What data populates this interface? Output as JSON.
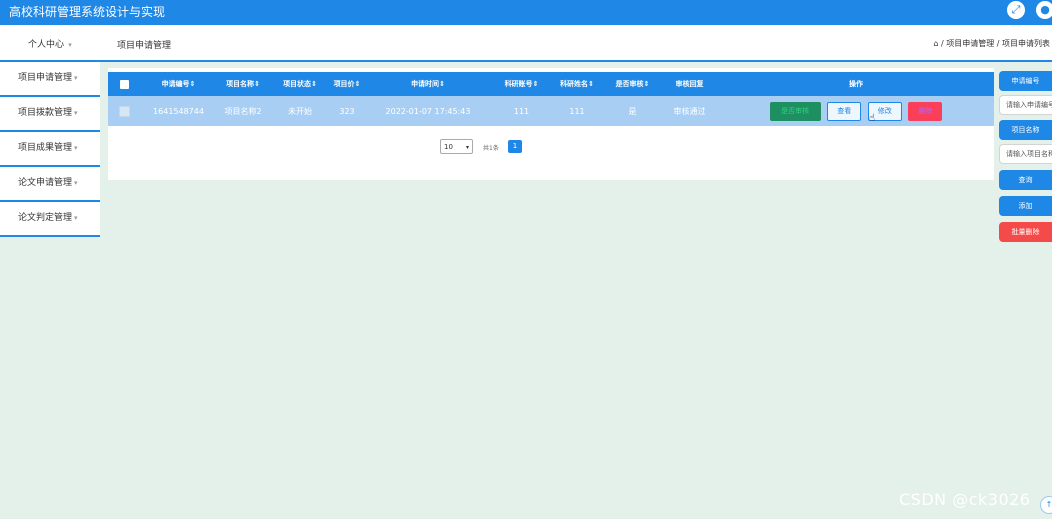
{
  "app": {
    "title": "高校科研管理系统设计与实现"
  },
  "icons": {
    "fullscreen": "expand-icon",
    "user": "user-icon",
    "home": "home-icon"
  },
  "header": {
    "user_center": "个人中心",
    "page_heading": "项目申请管理",
    "breadcrumb": "⌂ / 项目申请管理 / 项目申请列表"
  },
  "sidebar": {
    "items": [
      {
        "label": "项目申请管理"
      },
      {
        "label": "项目拨款管理"
      },
      {
        "label": "项目成果管理"
      },
      {
        "label": "论文申请管理"
      },
      {
        "label": "论文判定管理"
      }
    ]
  },
  "table": {
    "headers": [
      "申请编号",
      "项目名称",
      "项目状态",
      "项目价",
      "申请时间",
      "科研账号",
      "科研姓名",
      "是否审核",
      "审核回复",
      "操作"
    ],
    "rows": [
      {
        "id": "1641548744",
        "name": "项目名称2",
        "status": "未开始",
        "price": "323",
        "time": "2022-01-07 17:45:43",
        "account": "111",
        "researcher": "111",
        "audited": "是",
        "reply": "审核通过"
      }
    ],
    "actions": {
      "audit": "是否审核",
      "view": "查看",
      "edit": "修改",
      "delete": "删除"
    }
  },
  "pagination": {
    "page_size": "10",
    "total": "共1条",
    "current_page": "1"
  },
  "search": {
    "id_label": "申请编号",
    "id_placeholder": "请输入申请编号",
    "name_label": "项目名称",
    "name_placeholder": "请输入项目名称",
    "query": "查询",
    "add": "添加",
    "batch_delete": "批量删除"
  },
  "watermark": "CSDN @ck3026",
  "colors": {
    "primary": "#1f87e5",
    "danger": "#f54a4a",
    "background": "#e4f0ea"
  }
}
